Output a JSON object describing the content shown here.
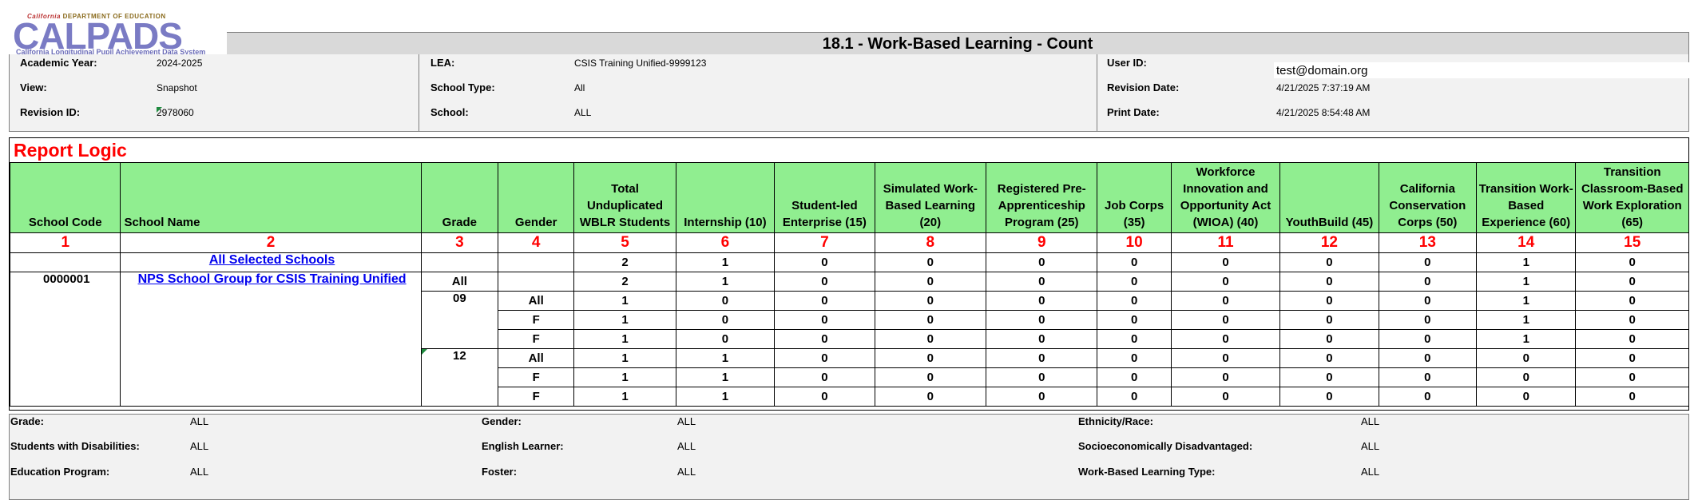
{
  "logo": {
    "dept_prefix": "California",
    "dept_text": "DEPARTMENT OF EDUCATION",
    "name": "CALPADS",
    "subtitle": "California Longitudinal Pupil Achievement Data System"
  },
  "report_title": "18.1 - Work-Based Learning - Count",
  "header": {
    "academic_year_label": "Academic Year:",
    "academic_year": "2024-2025",
    "view_label": "View:",
    "view": "Snapshot",
    "revision_id_label": "Revision ID:",
    "revision_id": "2978060",
    "lea_label": "LEA:",
    "lea": "CSIS Training Unified-9999123",
    "school_type_label": "School Type:",
    "school_type": "All",
    "school_label": "School:",
    "school": "ALL",
    "user_id_label": "User ID:",
    "user_id": "test@domain.org",
    "revision_date_label": "Revision Date:",
    "revision_date": "4/21/2025 7:37:19 AM",
    "print_date_label": "Print Date:",
    "print_date": "4/21/2025 8:54:48 AM"
  },
  "report_logic_title": "Report Logic",
  "columns": [
    "School Code",
    "School Name",
    "Grade",
    "Gender",
    "Total Unduplicated WBLR Students",
    "Internship (10)",
    "Student-led Enterprise (15)",
    "Simulated Work-Based Learning (20)",
    "Registered Pre-Apprenticeship Program (25)",
    "Job Corps (35)",
    "Workforce Innovation and Opportunity Act (WIOA) (40)",
    "YouthBuild (45)",
    "California Conservation Corps (50)",
    "Transition Work-Based Experience (60)",
    "Transition Classroom-Based Work Exploration (65)"
  ],
  "column_numbers": [
    "1",
    "2",
    "3",
    "4",
    "5",
    "6",
    "7",
    "8",
    "9",
    "10",
    "11",
    "12",
    "13",
    "14",
    "15"
  ],
  "rows": [
    {
      "school_code": "",
      "school_name": "All Selected Schools",
      "grade": "",
      "gender": "",
      "values": [
        "2",
        "1",
        "0",
        "0",
        "0",
        "0",
        "0",
        "0",
        "0",
        "1",
        "0"
      ]
    },
    {
      "school_code": "0000001",
      "school_name": "NPS School Group for CSIS Training Unified",
      "grade": "All",
      "gender": "",
      "values": [
        "2",
        "1",
        "0",
        "0",
        "0",
        "0",
        "0",
        "0",
        "0",
        "1",
        "0"
      ]
    },
    {
      "grade": "09",
      "gender": "All",
      "values": [
        "1",
        "0",
        "0",
        "0",
        "0",
        "0",
        "0",
        "0",
        "0",
        "1",
        "0"
      ]
    },
    {
      "grade": "",
      "gender": "F",
      "values": [
        "1",
        "0",
        "0",
        "0",
        "0",
        "0",
        "0",
        "0",
        "0",
        "1",
        "0"
      ]
    },
    {
      "grade": "",
      "gender": "F",
      "values": [
        "1",
        "0",
        "0",
        "0",
        "0",
        "0",
        "0",
        "0",
        "0",
        "1",
        "0"
      ]
    },
    {
      "grade": "12",
      "gender": "All",
      "values": [
        "1",
        "1",
        "0",
        "0",
        "0",
        "0",
        "0",
        "0",
        "0",
        "0",
        "0"
      ]
    },
    {
      "grade": "",
      "gender": "F",
      "values": [
        "1",
        "1",
        "0",
        "0",
        "0",
        "0",
        "0",
        "0",
        "0",
        "0",
        "0"
      ]
    },
    {
      "grade": "",
      "gender": "F",
      "values": [
        "1",
        "1",
        "0",
        "0",
        "0",
        "0",
        "0",
        "0",
        "0",
        "0",
        "0"
      ]
    }
  ],
  "footer": {
    "grade_label": "Grade:",
    "grade": "ALL",
    "gender_label": "Gender:",
    "gender": "ALL",
    "ethnicity_label": "Ethnicity/Race:",
    "ethnicity": "ALL",
    "swd_label": "Students with Disabilities:",
    "swd": "ALL",
    "el_label": "English Learner:",
    "el": "ALL",
    "sed_label": "Socioeconomically Disadvantaged:",
    "sed": "ALL",
    "edprog_label": "Education Program:",
    "edprog": "ALL",
    "foster_label": "Foster:",
    "foster": "ALL",
    "wbl_type_label": "Work-Based Learning Type:",
    "wbl_type": "ALL"
  }
}
